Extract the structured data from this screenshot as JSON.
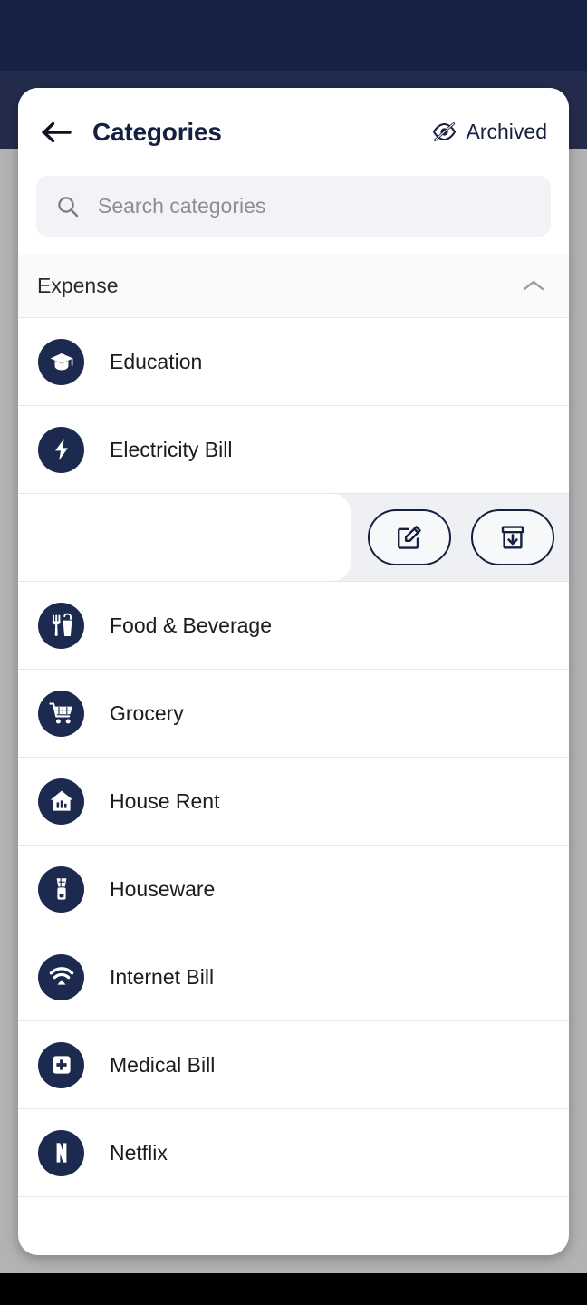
{
  "window": {
    "status_bar_color": "#172144",
    "app_bar_color": "#232c4c",
    "page_background": "#b3b3b3",
    "card_background": "#ffffff"
  },
  "header": {
    "back_icon": "arrow-left-icon",
    "title": "Categories",
    "archived_icon": "eye-off-icon",
    "archived_label": "Archived",
    "title_color": "#16203f"
  },
  "search": {
    "icon": "search-icon",
    "placeholder": "Search categories",
    "value": "",
    "background": "#f2f3f6"
  },
  "section": {
    "title": "Expense",
    "collapse_icon": "chevron-up-icon",
    "expanded": true
  },
  "swipe_actions": {
    "edit_icon": "edit-square-pencil-icon",
    "edit_label": "Edit",
    "archive_icon": "archive-box-down-arrow-icon",
    "archive_label": "Archive"
  },
  "categories": [
    {
      "label": "Education",
      "icon": "graduation-cap-icon",
      "swiped": false
    },
    {
      "label": "Electricity Bill",
      "icon": "lightning-bolt-icon",
      "swiped": false
    },
    {
      "label": "",
      "icon": "",
      "swiped": true
    },
    {
      "label": "Food & Beverage",
      "icon": "fork-and-cup-icon",
      "swiped": false
    },
    {
      "label": "Grocery",
      "icon": "shopping-cart-icon",
      "swiped": false
    },
    {
      "label": "House Rent",
      "icon": "house-bank-icon",
      "swiped": false
    },
    {
      "label": "Houseware",
      "icon": "blender-icon",
      "swiped": false
    },
    {
      "label": "Internet Bill",
      "icon": "wifi-icon",
      "swiped": false
    },
    {
      "label": "Medical Bill",
      "icon": "medical-cross-icon",
      "swiped": false
    },
    {
      "label": "Netflix",
      "icon": "netflix-n-icon",
      "swiped": false
    }
  ],
  "colors": {
    "icon_circle": "#1b2a4e",
    "accent_navy": "#16203f",
    "divider": "#e6e6e9",
    "muted_text": "#8d8d93"
  }
}
